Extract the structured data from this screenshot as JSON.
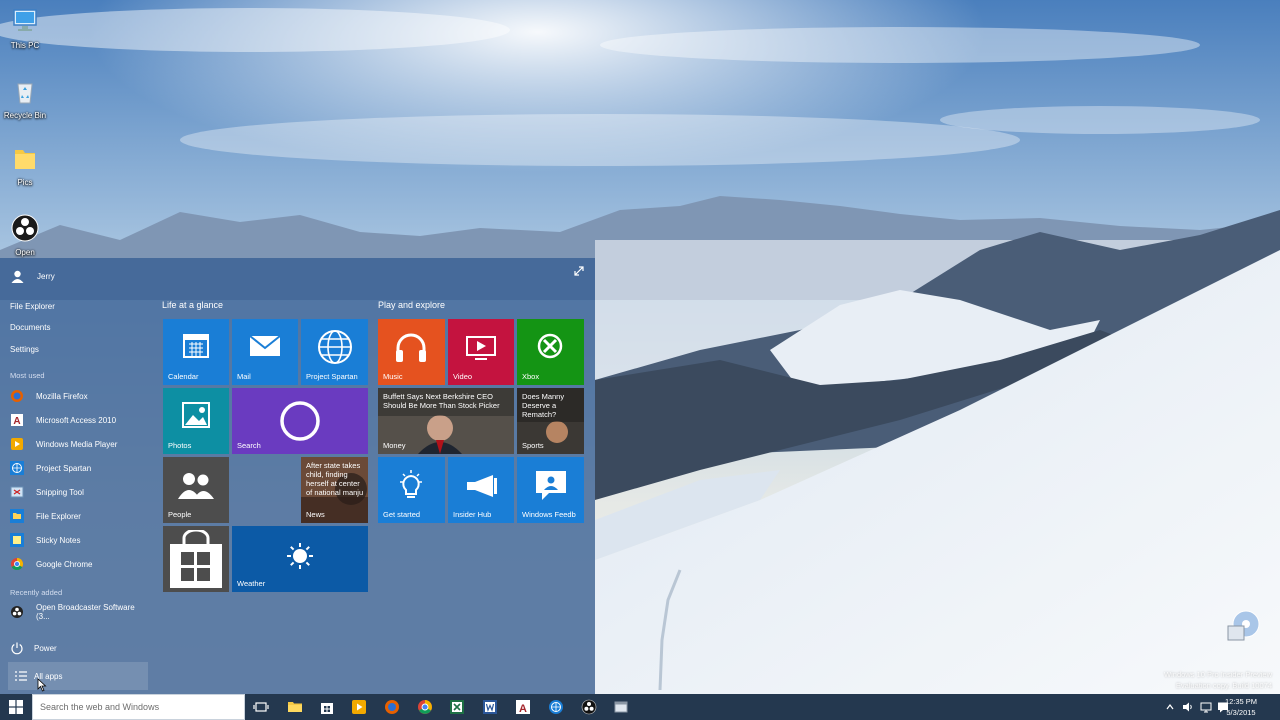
{
  "desktop_icons": [
    {
      "name": "this-pc",
      "label": "This PC",
      "icon": "computer-icon"
    },
    {
      "name": "recycle-bin",
      "label": "Recycle Bin",
      "icon": "recycle-bin-icon"
    },
    {
      "name": "pics",
      "label": "Pics",
      "icon": "folder-icon"
    },
    {
      "name": "open",
      "label": "Open",
      "icon": "obs-icon"
    }
  ],
  "start_menu": {
    "user": "Jerry",
    "places": [
      "File Explorer",
      "Documents",
      "Settings"
    ],
    "most_used_label": "Most used",
    "most_used": [
      {
        "label": "Mozilla Firefox",
        "icon": "firefox-icon"
      },
      {
        "label": "Microsoft Access 2010",
        "icon": "access-icon"
      },
      {
        "label": "Windows Media Player",
        "icon": "media-player-icon"
      },
      {
        "label": "Project Spartan",
        "icon": "globe-icon"
      },
      {
        "label": "Snipping Tool",
        "icon": "scissors-icon"
      },
      {
        "label": "File Explorer",
        "icon": "folder-icon"
      },
      {
        "label": "Sticky Notes",
        "icon": "sticky-note-icon"
      },
      {
        "label": "Google Chrome",
        "icon": "chrome-icon"
      }
    ],
    "recently_added_label": "Recently added",
    "recently_added": [
      {
        "label": "Open Broadcaster Software (3...",
        "icon": "obs-icon"
      }
    ],
    "power_label": "Power",
    "all_apps_label": "All apps",
    "groups": [
      "Life at a glance",
      "Play and explore"
    ],
    "tiles": {
      "calendar": "Calendar",
      "mail": "Mail",
      "spartan": "Project Spartan",
      "photos": "Photos",
      "search": "Search",
      "people": "People",
      "news": "News",
      "news_headline": "After state takes child, finding herself at center of national manju",
      "weather": "Weather",
      "music": "Music",
      "video": "Video",
      "xbox": "Xbox",
      "money": "Money",
      "money_headline": "Buffett Says Next Berkshire CEO Should Be More Than Stock Picker",
      "sports": "Sports",
      "sports_headline": "Does Manny Deserve a Rematch?",
      "get_started": "Get started",
      "insider_hub": "Insider Hub",
      "windows_feedback": "Windows Feedb"
    }
  },
  "taskbar": {
    "search_placeholder": "Search the web and Windows",
    "time": "12:35 PM",
    "date": "5/3/2015"
  },
  "watermark": {
    "line1": "Windows 10 Pro Insider Preview",
    "line2": "Evaluation copy. Build 10074"
  },
  "colors": {
    "start_bg": "#365d92",
    "tile_blue": "#1a7ed6",
    "tile_teal": "#0d8fa3",
    "tile_purple": "#6a3bc0",
    "tile_orange": "#e5521f",
    "tile_crimson": "#c4133f",
    "tile_green": "#149414",
    "tile_grey": "#4d4d4d",
    "tile_darkblue": "#0c5aa6",
    "taskbar_bg": "#24384f"
  }
}
